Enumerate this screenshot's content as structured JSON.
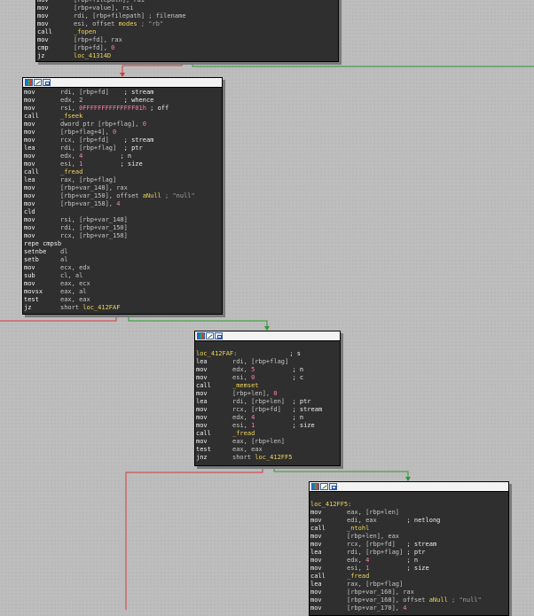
{
  "colors": {
    "canvas": "#bdbdbd",
    "node_bg": "#2f2f2f",
    "true_edge": "#2a9a2a",
    "false_edge": "#d33a3a",
    "symbol": "#f2d65a",
    "variable": "#ff7fb0"
  },
  "title_icons": [
    "color-icon",
    "edit-icon",
    "graph-icon"
  ],
  "block0": {
    "lines": [
      [
        {
          "m": "mov"
        },
        {
          "o": "[rbp+filepath], rdi"
        }
      ],
      [
        {
          "m": "mov"
        },
        {
          "o": "[rbp+value], rsi"
        }
      ],
      [
        {
          "m": "mov"
        },
        {
          "o": "rdi, [rbp+filepath] ; filename"
        }
      ],
      [
        {
          "m": "mov"
        },
        {
          "o": "esi, offset "
        },
        {
          "y": "modes"
        },
        {
          "g": " ; \"rb\""
        }
      ],
      [
        {
          "m": "call"
        },
        {
          "y": "_fopen"
        }
      ],
      [
        {
          "m": "mov"
        },
        {
          "o": "[rbp+fd], rax"
        }
      ],
      [
        {
          "m": "cmp"
        },
        {
          "o": "[rbp+fd], "
        },
        {
          "p": "0"
        }
      ],
      [
        {
          "m": "jz"
        },
        {
          "y": "loc_41314D"
        }
      ]
    ]
  },
  "block1": {
    "lines": [
      [
        {
          "m": "mov"
        },
        {
          "o": "rdi, [rbp+fd]    "
        },
        {
          "c": "; stream"
        }
      ],
      [
        {
          "m": "mov"
        },
        {
          "o": "edx, 2           "
        },
        {
          "c": "; whence"
        }
      ],
      [
        {
          "m": "mov"
        },
        {
          "o": "rsi, "
        },
        {
          "p": "0FFFFFFFFFFFFFF01h"
        },
        {
          "c": " ; off"
        }
      ],
      [
        {
          "m": "call"
        },
        {
          "y": "_fseek"
        }
      ],
      [
        {
          "m": "mov"
        },
        {
          "o": "dword ptr [rbp+flag], "
        },
        {
          "p": "0"
        }
      ],
      [
        {
          "m": "mov"
        },
        {
          "o": "[rbp+flag+4], "
        },
        {
          "p": "0"
        }
      ],
      [
        {
          "m": "mov"
        },
        {
          "o": "rcx, [rbp+fd]    "
        },
        {
          "c": "; stream"
        }
      ],
      [
        {
          "m": "lea"
        },
        {
          "o": "rdi, [rbp+flag]  "
        },
        {
          "c": "; ptr"
        }
      ],
      [
        {
          "m": "mov"
        },
        {
          "o": "edx, "
        },
        {
          "p": "4"
        },
        {
          "o": "          "
        },
        {
          "c": "; n"
        }
      ],
      [
        {
          "m": "mov"
        },
        {
          "o": "esi, "
        },
        {
          "p": "1"
        },
        {
          "o": "          "
        },
        {
          "c": "; size"
        }
      ],
      [
        {
          "m": "call"
        },
        {
          "y": "_fread"
        }
      ],
      [
        {
          "m": "lea"
        },
        {
          "o": "rax, [rbp+flag]"
        }
      ],
      [
        {
          "m": "mov"
        },
        {
          "o": "[rbp+var_148], rax"
        }
      ],
      [
        {
          "m": "mov"
        },
        {
          "o": "[rbp+var_150], offset "
        },
        {
          "y": "aNull"
        },
        {
          "g": " ; \"null\""
        }
      ],
      [
        {
          "m": "mov"
        },
        {
          "o": "[rbp+var_158], "
        },
        {
          "p": "4"
        }
      ],
      [
        {
          "m": "cld"
        }
      ],
      [
        {
          "m": "mov"
        },
        {
          "o": "rsi, [rbp+var_148]"
        }
      ],
      [
        {
          "m": "mov"
        },
        {
          "o": "rdi, [rbp+var_150]"
        }
      ],
      [
        {
          "m": "mov"
        },
        {
          "o": "rcx, [rbp+var_158]"
        }
      ],
      [
        {
          "m": "repe cmpsb"
        }
      ],
      [
        {
          "m": "setnbe"
        },
        {
          "o": "dl"
        }
      ],
      [
        {
          "m": "setb"
        },
        {
          "o": "al"
        }
      ],
      [
        {
          "m": "mov"
        },
        {
          "o": "ecx, edx"
        }
      ],
      [
        {
          "m": "sub"
        },
        {
          "o": "cl, al"
        }
      ],
      [
        {
          "m": "mov"
        },
        {
          "o": "eax, ecx"
        }
      ],
      [
        {
          "m": "movsx"
        },
        {
          "o": "eax, al"
        }
      ],
      [
        {
          "m": "test"
        },
        {
          "o": "eax, eax"
        }
      ],
      [
        {
          "m": "jz"
        },
        {
          "o": "short "
        },
        {
          "y": "loc_412FAF"
        }
      ]
    ]
  },
  "block2": {
    "lines": [
      [],
      [
        {
          "l": "loc_412FAF:"
        },
        {
          "o": "              "
        },
        {
          "c": "; s"
        }
      ],
      [
        {
          "m": "lea"
        },
        {
          "o": "rdi, [rbp+flag]"
        }
      ],
      [
        {
          "m": "mov"
        },
        {
          "o": "edx, "
        },
        {
          "p": "5"
        },
        {
          "o": "          "
        },
        {
          "c": "; n"
        }
      ],
      [
        {
          "m": "mov"
        },
        {
          "o": "esi, "
        },
        {
          "p": "0"
        },
        {
          "o": "          "
        },
        {
          "c": "; c"
        }
      ],
      [
        {
          "m": "call"
        },
        {
          "y": "_memset"
        }
      ],
      [
        {
          "m": "mov"
        },
        {
          "o": "[rbp+len], "
        },
        {
          "p": "0"
        }
      ],
      [
        {
          "m": "lea"
        },
        {
          "o": "rdi, [rbp+len]  "
        },
        {
          "c": "; ptr"
        }
      ],
      [
        {
          "m": "mov"
        },
        {
          "o": "rcx, [rbp+fd]   "
        },
        {
          "c": "; stream"
        }
      ],
      [
        {
          "m": "mov"
        },
        {
          "o": "edx, "
        },
        {
          "p": "4"
        },
        {
          "o": "          "
        },
        {
          "c": "; n"
        }
      ],
      [
        {
          "m": "mov"
        },
        {
          "o": "esi, "
        },
        {
          "p": "1"
        },
        {
          "o": "          "
        },
        {
          "c": "; size"
        }
      ],
      [
        {
          "m": "call"
        },
        {
          "y": "_fread"
        }
      ],
      [
        {
          "m": "mov"
        },
        {
          "o": "eax, [rbp+len]"
        }
      ],
      [
        {
          "m": "test"
        },
        {
          "o": "eax, eax"
        }
      ],
      [
        {
          "m": "jnz"
        },
        {
          "o": "short "
        },
        {
          "y": "loc_412FF5"
        }
      ]
    ]
  },
  "block3": {
    "lines": [
      [],
      [
        {
          "l": "loc_412FF5:"
        }
      ],
      [
        {
          "m": "mov"
        },
        {
          "o": "eax, [rbp+len]"
        }
      ],
      [
        {
          "m": "mov"
        },
        {
          "o": "edi, eax        "
        },
        {
          "c": "; netlong"
        }
      ],
      [
        {
          "m": "call"
        },
        {
          "y": "_ntohl"
        }
      ],
      [
        {
          "m": "mov"
        },
        {
          "o": "[rbp+len], eax"
        }
      ],
      [
        {
          "m": "mov"
        },
        {
          "o": "rcx, [rbp+fd]   "
        },
        {
          "c": "; stream"
        }
      ],
      [
        {
          "m": "lea"
        },
        {
          "o": "rdi, [rbp+flag] "
        },
        {
          "c": "; ptr"
        }
      ],
      [
        {
          "m": "mov"
        },
        {
          "o": "edx, "
        },
        {
          "p": "4"
        },
        {
          "o": "          "
        },
        {
          "c": "; n"
        }
      ],
      [
        {
          "m": "mov"
        },
        {
          "o": "esi, "
        },
        {
          "p": "1"
        },
        {
          "o": "          "
        },
        {
          "c": "; size"
        }
      ],
      [
        {
          "m": "call"
        },
        {
          "y": "_fread"
        }
      ],
      [
        {
          "m": "lea"
        },
        {
          "o": "rax, [rbp+flag]"
        }
      ],
      [
        {
          "m": "mov"
        },
        {
          "o": "[rbp+var_160], rax"
        }
      ],
      [
        {
          "m": "mov"
        },
        {
          "o": "[rbp+var_168], offset "
        },
        {
          "y": "aNull"
        },
        {
          "g": " ; \"null\""
        }
      ],
      [
        {
          "m": "mov"
        },
        {
          "o": "[rbp+var_170], "
        },
        {
          "p": "4"
        }
      ]
    ]
  }
}
